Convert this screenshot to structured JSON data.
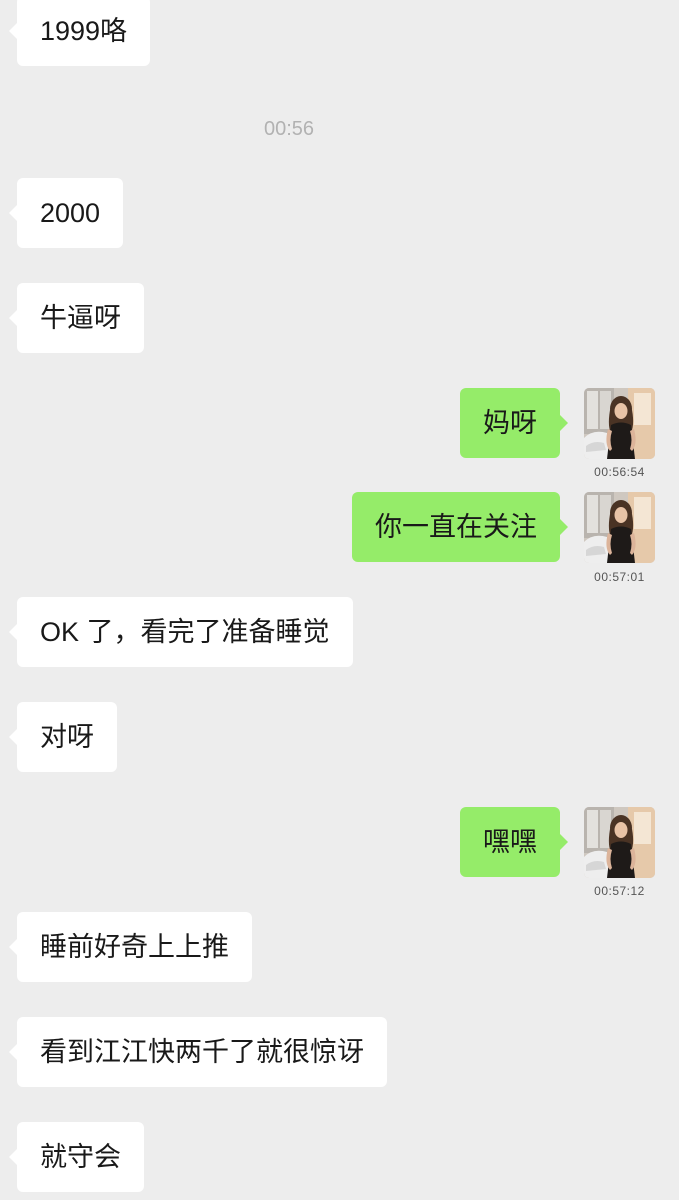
{
  "colors": {
    "background": "#ededed",
    "received_bubble": "#ffffff",
    "sent_bubble": "#95ec69",
    "text": "#191919",
    "time_divider": "#b2b2b2"
  },
  "messages": [
    {
      "received": "1999咯"
    },
    {
      "timestamp": "00:56"
    },
    {
      "received": "2000"
    },
    {
      "received": "牛逼呀"
    },
    {
      "sent": "妈呀",
      "sent_at": "00:56:54"
    },
    {
      "sent": "你一直在关注",
      "sent_at": "00:57:01"
    },
    {
      "received": "OK 了，看完了准备睡觉"
    },
    {
      "received": "对呀"
    },
    {
      "sent": "嘿嘿",
      "sent_at": "00:57:12"
    },
    {
      "received": "睡前好奇上上推"
    },
    {
      "received": "看到江江快两千了就很惊讶"
    },
    {
      "received": "就守会"
    }
  ]
}
